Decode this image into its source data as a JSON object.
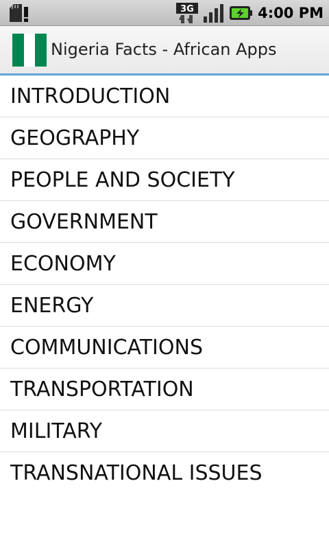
{
  "status_bar": {
    "time": "4:00 PM",
    "network": "3G",
    "icons": [
      "sd-card-warning-icon",
      "3g-data-icon",
      "signal-strength-icon",
      "battery-charging-icon"
    ]
  },
  "app": {
    "title": "Nigeria Facts - African Apps",
    "flag_colors": [
      "#008751",
      "#ffffff",
      "#008751"
    ]
  },
  "menu": {
    "items": [
      {
        "label": "INTRODUCTION"
      },
      {
        "label": "GEOGRAPHY"
      },
      {
        "label": "PEOPLE AND SOCIETY"
      },
      {
        "label": "GOVERNMENT"
      },
      {
        "label": "ECONOMY"
      },
      {
        "label": "ENERGY"
      },
      {
        "label": "COMMUNICATIONS"
      },
      {
        "label": "TRANSPORTATION"
      },
      {
        "label": "MILITARY"
      },
      {
        "label": "TRANSNATIONAL ISSUES"
      }
    ]
  },
  "colors": {
    "accent": "#5ea7d6",
    "flag_green": "#008751"
  }
}
